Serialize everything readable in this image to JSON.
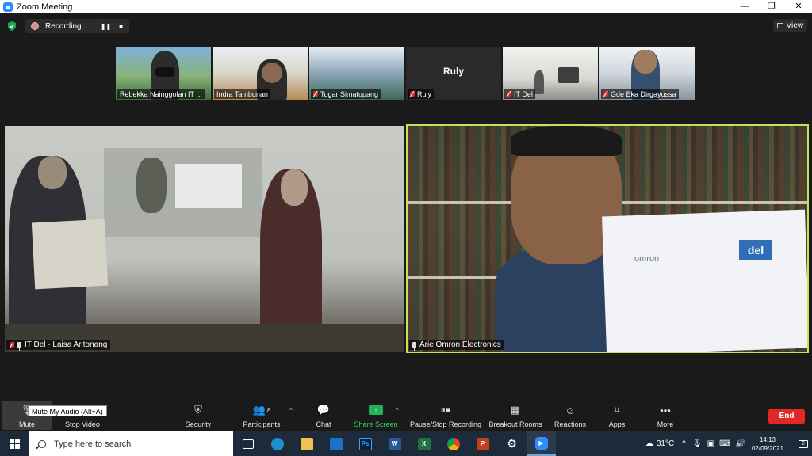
{
  "window": {
    "title": "Zoom Meeting",
    "controls": [
      "—",
      "❐",
      "✕"
    ]
  },
  "recording": {
    "status": "Recording...",
    "pause_icon": "pause-icon",
    "stop_icon": "stop-icon"
  },
  "view_button": {
    "label": "View"
  },
  "thumbnails": [
    {
      "name": "Rebekka Nainggolan IT ...",
      "muted": false
    },
    {
      "name": "Indra Tambunan",
      "muted": false
    },
    {
      "name": "Togar Simatupang",
      "muted": true
    },
    {
      "name": "Ruly",
      "muted": true,
      "center_name": "Ruly"
    },
    {
      "name": "IT Del",
      "muted": true
    },
    {
      "name": "Gde Eka Dirgayussa",
      "muted": true
    }
  ],
  "main_videos": {
    "left": {
      "name": "IT Del - Laisa Aritonang"
    },
    "right": {
      "name": "Arie Omron Electronics",
      "document_brand_left": "omron",
      "document_brand_right": "del"
    }
  },
  "tooltip": {
    "text": "Mute My Audio (Alt+A)"
  },
  "toolbar": {
    "mute": "Mute",
    "stop_video": "Stop Video",
    "security": "Security",
    "participants": "Participants",
    "participants_count": "8",
    "chat": "Chat",
    "share_screen": "Share Screen",
    "pause_stop_recording": "Pause/Stop Recording",
    "breakout_rooms": "Breakout Rooms",
    "reactions": "Reactions",
    "apps": "Apps",
    "more": "More",
    "end": "End"
  },
  "taskbar": {
    "search_placeholder": "Type here to search",
    "apps": [
      "task-view",
      "edge",
      "file-explorer",
      "mail",
      "photoshop",
      "word",
      "excel",
      "chrome",
      "powerpoint",
      "settings",
      "zoom"
    ],
    "app_letters": {
      "photoshop": "Ps",
      "word": "W",
      "excel": "X",
      "powerpoint": "P"
    },
    "weather": "31°C",
    "time": "14:13",
    "date": "02/09/2021",
    "notification_count": "2"
  },
  "colors": {
    "accent_share": "#1fb356",
    "end_button": "#e02828",
    "active_speaker_border": "#c7e05a",
    "zoom_blue": "#2d8cff"
  }
}
